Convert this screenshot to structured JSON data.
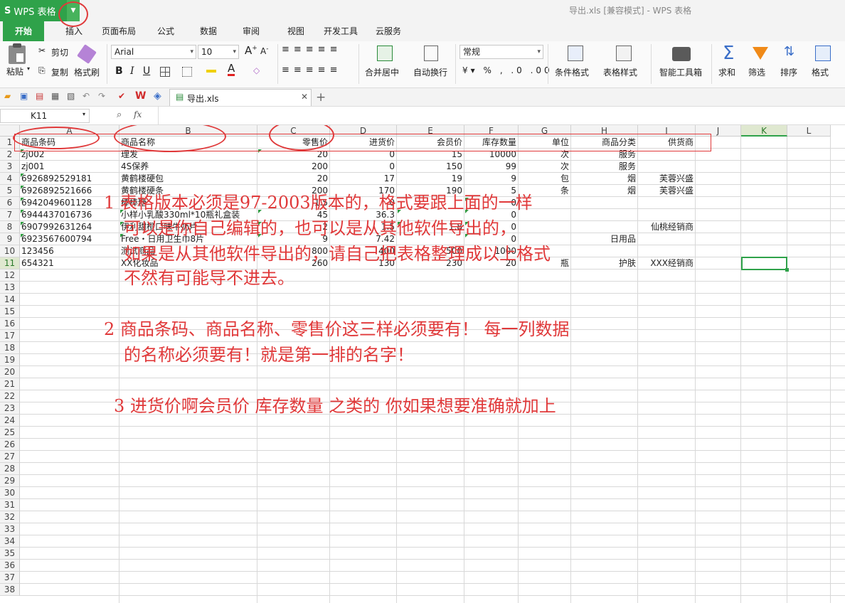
{
  "app": {
    "name": "WPS 表格",
    "window_title": "导出.xls [兼容模式] - WPS 表格"
  },
  "ribbon_tabs": [
    "开始",
    "插入",
    "页面布局",
    "公式",
    "数据",
    "审阅",
    "视图",
    "开发工具",
    "云服务"
  ],
  "ribbon": {
    "paste": "粘贴",
    "cut": "剪切",
    "copy": "复制",
    "format_painter": "格式刷",
    "font_name": "Arial",
    "font_size": "10",
    "merge_center": "合并居中",
    "wrap": "自动换行",
    "number_format": "常规",
    "cond_format": "条件格式",
    "table_style": "表格样式",
    "smart_tools": "智能工具箱",
    "sum": "求和",
    "filter": "筛选",
    "sort": "排序",
    "format": "格式"
  },
  "doc_tab": "导出.xls",
  "name_box": "K11",
  "fx_label": "fx",
  "columns": [
    "A",
    "B",
    "C",
    "D",
    "E",
    "F",
    "G",
    "H",
    "I",
    "J",
    "K",
    "L"
  ],
  "selected_column": "K",
  "selected_row": 11,
  "row_numbers": [
    "1",
    "2",
    "3",
    "4",
    "5",
    "6",
    "7",
    "8",
    "9",
    "10",
    "11",
    "12",
    "13",
    "14",
    "15",
    "16",
    "17",
    "18",
    "19",
    "20",
    "21",
    "22",
    "23",
    "24",
    "25",
    "26",
    "27",
    "28",
    "29",
    "30",
    "31",
    "32",
    "33",
    "34",
    "35",
    "36",
    "37",
    "38"
  ],
  "header_row": [
    "商品条码",
    "商品名称",
    "零售价",
    "进货价",
    "会员价",
    "库存数量",
    "单位",
    "商品分类",
    "供货商"
  ],
  "rows": [
    [
      "zj002",
      "理发",
      "20",
      "0",
      "15",
      "10000",
      "次",
      "服务",
      ""
    ],
    [
      "zj001",
      "4S保养",
      "200",
      "0",
      "150",
      "99",
      "次",
      "服务",
      ""
    ],
    [
      "6926892529181",
      "黄鹤楼硬包",
      "20",
      "17",
      "19",
      "9",
      "包",
      "烟",
      "芙蓉兴盛"
    ],
    [
      "6926892521666",
      "黄鹤楼硬条",
      "200",
      "170",
      "190",
      "5",
      "条",
      "烟",
      "芙蓉兴盛"
    ],
    [
      "6942049601128",
      "棒棒糖",
      "1.5",
      "0",
      "",
      "0",
      "",
      "",
      ""
    ],
    [
      "6944437016736",
      "小样小乳酸330ml*10瓶礼盒装",
      "45",
      "36.3",
      "",
      "0",
      "",
      "",
      ""
    ],
    [
      "6907992631264",
      "伊利甜橙口味牛奶片",
      "2",
      "1.5",
      "1.8",
      "0",
      "",
      "",
      "仙桃经销商"
    ],
    [
      "6923567600794",
      "Free・日用卫生巾8片",
      "9",
      "7.42",
      "",
      "0",
      "",
      "日用品",
      ""
    ],
    [
      "123456",
      "测试商品",
      "800",
      "400",
      "500",
      "1000",
      "",
      "",
      ""
    ],
    [
      "654321",
      "XX化妆品",
      "260",
      "130",
      "230",
      "20",
      "瓶",
      "护肤",
      "XXX经销商"
    ]
  ],
  "notes": [
    "1 表格版本必须是97-2003版本的，格式要跟上面的一样",
    "可以是你自己编辑的，也可以是从其他软件导出的，",
    "如果是从其他软件导出的，请自己把表格整理成以上格式",
    "不然有可能导不进去。",
    "2 商品条码、商品名称、零售价这三样必须要有！ 每一列数据",
    "的名称必须要有！就是第一排的名字！",
    "3 进货价啊会员价 库存数量 之类的 你如果想要准确就加上"
  ],
  "colors": {
    "accent": "#2fa24a",
    "annotation": "#e0393a"
  }
}
